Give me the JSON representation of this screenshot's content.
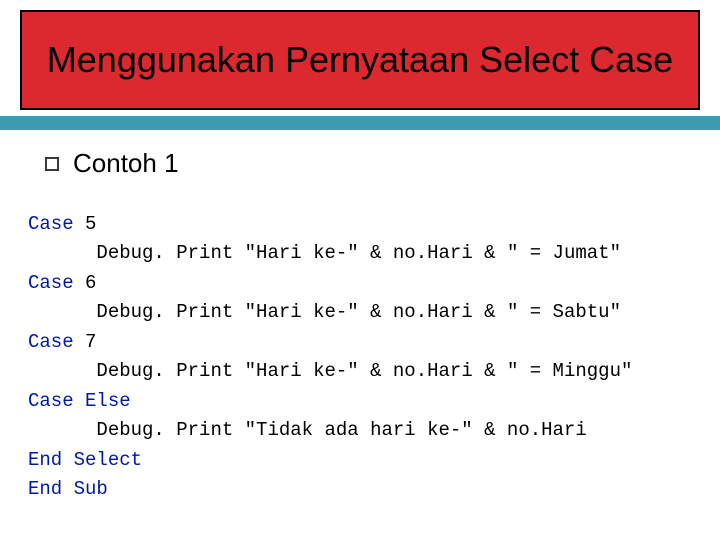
{
  "title": "Menggunakan Pernyataan Select Case",
  "bullet": "Contoh 1",
  "code": {
    "kw_case": "Case",
    "kw_else": "Else",
    "kw_end": "End",
    "kw_select": "Select",
    "kw_sub": "Sub",
    "debug_print": "Debug. Print",
    "n5": "5",
    "n6": "6",
    "n7": "7",
    "str_hariKe": "\"Hari ke-\"",
    "amp": " & ",
    "var_noHari": "no.Hari",
    "str_jumat": "\" = Jumat\"",
    "str_sabtu": "\" = Sabtu\"",
    "str_minggu": "\" = Minggu\"",
    "str_tidak": "\"Tidak ada hari ke-\""
  }
}
